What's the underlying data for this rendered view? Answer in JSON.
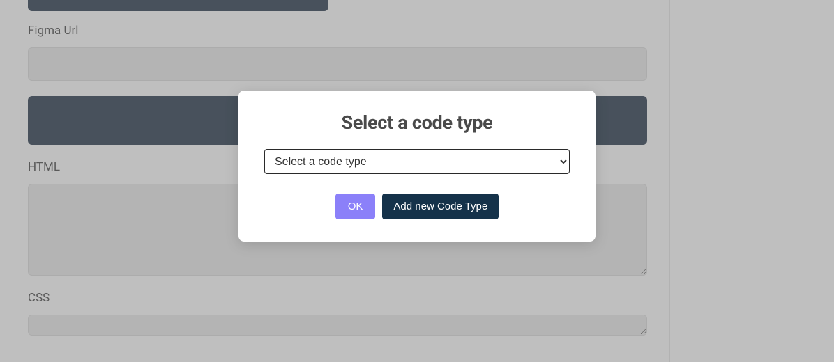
{
  "form": {
    "figma_url_label": "Figma Url",
    "figma_url_value": "",
    "html_label": "HTML",
    "html_value": "",
    "css_label": "CSS",
    "css_value": ""
  },
  "modal": {
    "title": "Select a code type",
    "select_placeholder": "Select a code type",
    "ok_label": "OK",
    "add_label": "Add new Code Type"
  }
}
